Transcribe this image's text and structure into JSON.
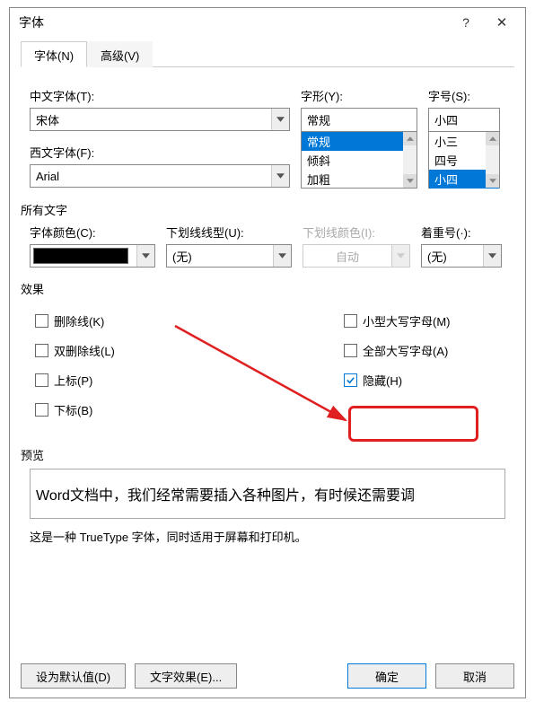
{
  "dialog": {
    "title": "字体",
    "help": "?",
    "close": "✕"
  },
  "tabs": {
    "font": "字体(N)",
    "advanced": "高级(V)"
  },
  "labels": {
    "cn_font": "中文字体(T):",
    "west_font": "西文字体(F):",
    "style": "字形(Y):",
    "size": "字号(S):",
    "all_text": "所有文字",
    "font_color": "字体颜色(C):",
    "underline_style": "下划线线型(U):",
    "underline_color": "下划线颜色(I):",
    "emphasis": "着重号(·):",
    "effects": "效果",
    "preview": "预览"
  },
  "fields": {
    "cn_font": "宋体",
    "west_font": "Arial",
    "style_value": "常规",
    "size_value": "小四",
    "underline_style": "(无)",
    "underline_color": "自动",
    "emphasis": "(无)"
  },
  "style_options": [
    "常规",
    "倾斜",
    "加粗"
  ],
  "size_options": [
    "小三",
    "四号",
    "小四"
  ],
  "effects_left": {
    "strikethrough": "删除线(K)",
    "double_strike": "双删除线(L)",
    "superscript": "上标(P)",
    "subscript": "下标(B)"
  },
  "effects_right": {
    "small_caps": "小型大写字母(M)",
    "all_caps": "全部大写字母(A)",
    "hidden": "隐藏(H)"
  },
  "preview": {
    "text": "Word文档中，我们经常需要插入各种图片，有时候还需要调",
    "note": "这是一种 TrueType 字体，同时适用于屏幕和打印机。"
  },
  "buttons": {
    "set_default": "设为默认值(D)",
    "text_effects": "文字效果(E)...",
    "ok": "确定",
    "cancel": "取消"
  }
}
